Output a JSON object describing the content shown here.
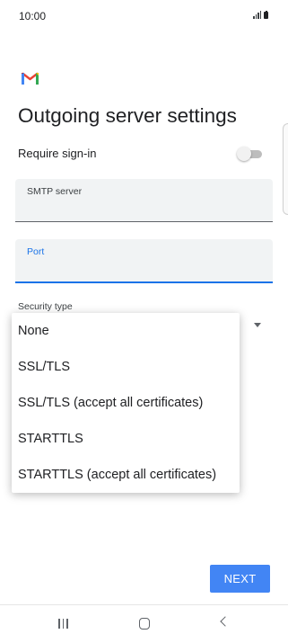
{
  "status_bar": {
    "time": "10:00"
  },
  "header": {
    "title": "Outgoing server settings"
  },
  "require_signin": {
    "label": "Require sign-in",
    "enabled": false
  },
  "smtp_server": {
    "label": "SMTP server",
    "value": ""
  },
  "port": {
    "label": "Port",
    "value": ""
  },
  "security_type": {
    "label": "Security type",
    "options": [
      "None",
      "SSL/TLS",
      "SSL/TLS (accept all certificates)",
      "STARTTLS",
      "STARTTLS (accept all certificates)"
    ]
  },
  "footer": {
    "next_label": "NEXT"
  },
  "colors": {
    "accent": "#1a73e8",
    "button": "#4285f4"
  }
}
